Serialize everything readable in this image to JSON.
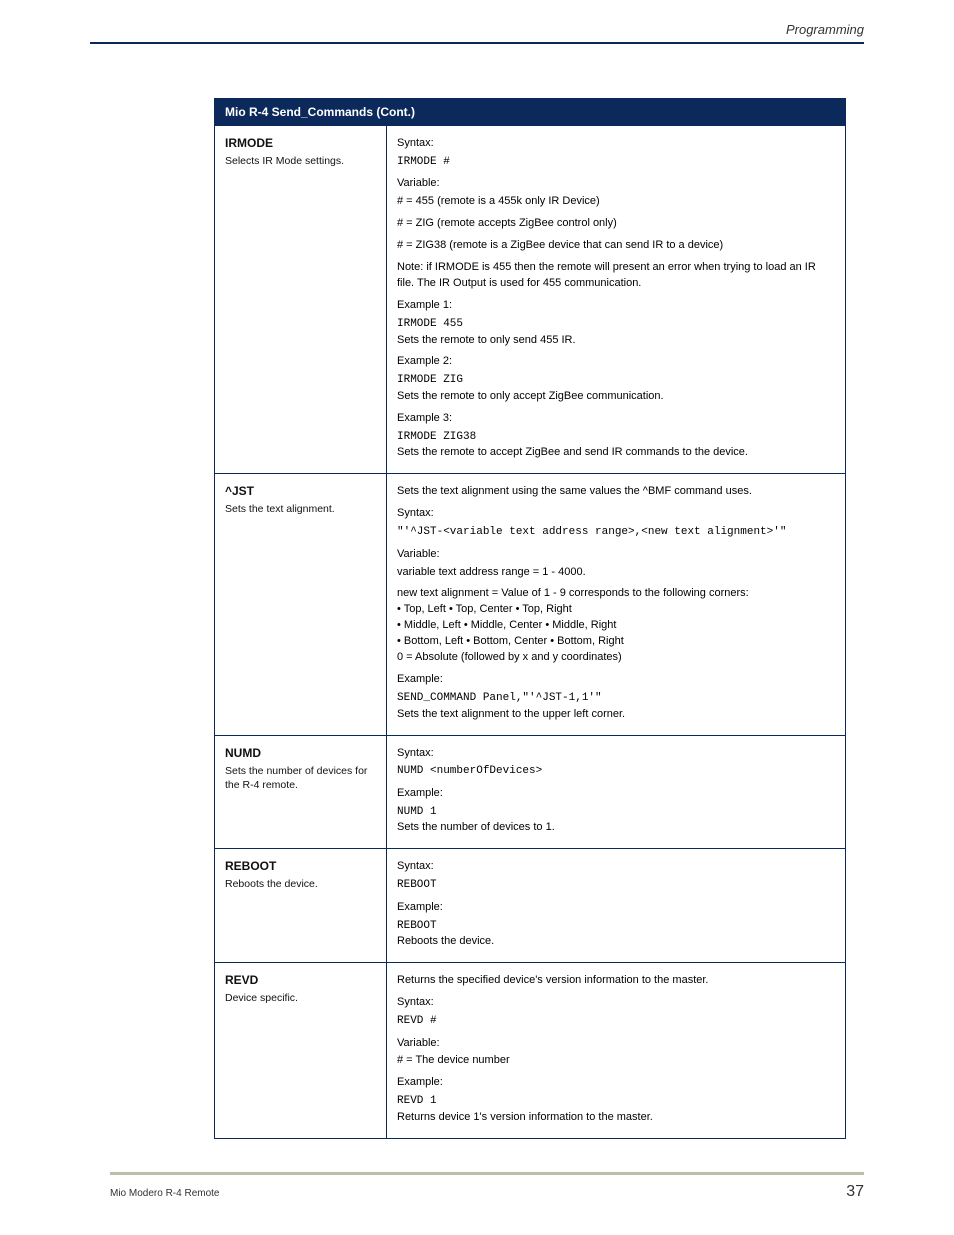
{
  "header": {
    "section_title": "Programming",
    "footer_doc": "Mio Modero R-4 Remote",
    "page_number": "37"
  },
  "table": {
    "title": "Mio R-4 Send_Commands (Cont.)",
    "rows": [
      {
        "name": "IRMODE",
        "desc": "Selects IR Mode settings.",
        "right": {
          "syntax_label": "Syntax:",
          "syntax_code": "IRMODE #",
          "variable_label": "Variable:",
          "variable_lines": [
            "# = 455 (remote is a 455k only IR Device)",
            "# = ZIG (remote accepts ZigBee control only)",
            "# = ZIG38 (remote is a ZigBee device that can send IR to a device)"
          ],
          "note": "Note: if IRMODE is 455 then the remote will present an error when trying to load an IR file. The IR Output is used for 455 communication.",
          "example1_label": "Example 1:",
          "example1_code": "IRMODE 455",
          "example1_text": "Sets the remote to only send 455 IR.",
          "example2_label": "Example 2:",
          "example2_code": "IRMODE ZIG",
          "example2_text": "Sets the remote to only accept ZigBee communication.",
          "example3_label": "Example 3:",
          "example3_code": "IRMODE ZIG38",
          "example3_text": "Sets the remote to accept ZigBee and send IR commands to the device."
        }
      },
      {
        "name": "^JST",
        "desc": "Sets the text alignment.",
        "right": {
          "intro": "Sets the text alignment using the same values the ^BMF command uses.",
          "syntax_label": "Syntax:",
          "syntax_code": "\"'^JST-<variable text address range>,<new text alignment>'\"",
          "variable_label": "Variable:",
          "variable_lines": [
            "variable text address range = 1 - 4000.",
            "new text alignment = Value of 1 - 9 corresponds to the following corners:",
            "• Top, Left   • Top, Center   • Top, Right",
            "• Middle, Left   • Middle, Center   • Middle, Right",
            "• Bottom, Left   • Bottom, Center   • Bottom, Right",
            "0 = Absolute (followed by x and y coordinates)"
          ],
          "example_label": "Example:",
          "example_code": "SEND_COMMAND Panel,\"'^JST-1,1'\"",
          "example_text": "Sets the text alignment to the upper left corner."
        }
      },
      {
        "name": "NUMD",
        "desc": "Sets the number of devices for the R-4 remote.",
        "right": {
          "syntax_label": "Syntax:",
          "syntax_code": "NUMD <numberOfDevices>",
          "example_label": "Example:",
          "example_code": "NUMD 1",
          "example_text": "Sets the number of devices to 1."
        }
      },
      {
        "name": "REBOOT",
        "desc": "Reboots the device.",
        "right": {
          "syntax_label": "Syntax:",
          "syntax_code": "REBOOT",
          "example_label": "Example:",
          "example_code": "REBOOT",
          "example_text": "Reboots the device."
        }
      },
      {
        "name": "REVD",
        "desc": "Device specific.",
        "right": {
          "intro": "Returns the specified device's version information to the master.",
          "syntax_label": "Syntax:",
          "syntax_code": "REVD #",
          "variable_label": "Variable:",
          "variable_lines": [
            "# = The device number"
          ],
          "example_label": "Example:",
          "example_code": "REVD 1",
          "example_text": "Returns device 1's version information to the master."
        }
      }
    ]
  }
}
